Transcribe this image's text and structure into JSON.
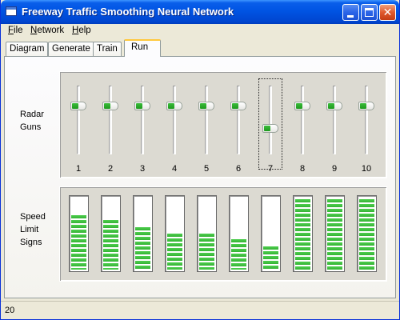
{
  "window": {
    "title": "Freeway Traffic Smoothing Neural Network",
    "app_icon": "window-app-icon",
    "controls": {
      "minimize_icon": "minimize-icon",
      "maximize_icon": "maximize-icon",
      "close_icon": "close-icon",
      "close_glyph": "✕"
    }
  },
  "menu": [
    {
      "mnemonic": "F",
      "rest": "ile"
    },
    {
      "mnemonic": "N",
      "rest": "etwork"
    },
    {
      "mnemonic": "H",
      "rest": "elp"
    }
  ],
  "tabs": {
    "items": [
      "Diagram",
      "Generate",
      "Train",
      "Run"
    ],
    "active": "Run"
  },
  "run": {
    "radar_label": "Radar\nGuns",
    "speed_label": "Speed\nLimit\nSigns",
    "radar_guns": [
      {
        "label": "1",
        "level": 0.74
      },
      {
        "label": "2",
        "level": 0.74
      },
      {
        "label": "3",
        "level": 0.74
      },
      {
        "label": "4",
        "level": 0.74
      },
      {
        "label": "5",
        "level": 0.74
      },
      {
        "label": "6",
        "level": 0.74
      },
      {
        "label": "7",
        "level": 0.36,
        "focused": true
      },
      {
        "label": "8",
        "level": 0.74
      },
      {
        "label": "9",
        "level": 0.74
      },
      {
        "label": "10",
        "level": 0.74
      }
    ],
    "speed_signs": [
      {
        "level": 0.74
      },
      {
        "level": 0.67
      },
      {
        "level": 0.58
      },
      {
        "level": 0.49
      },
      {
        "level": 0.49
      },
      {
        "level": 0.41
      },
      {
        "level": 0.32
      },
      {
        "level": 0.96
      },
      {
        "level": 0.96
      },
      {
        "level": 0.96
      }
    ]
  },
  "colors": {
    "titlebar": "#0054e3",
    "meter_green": "#34b334",
    "active_tab_accent": "#ffc83c"
  },
  "status": {
    "text": "20"
  }
}
